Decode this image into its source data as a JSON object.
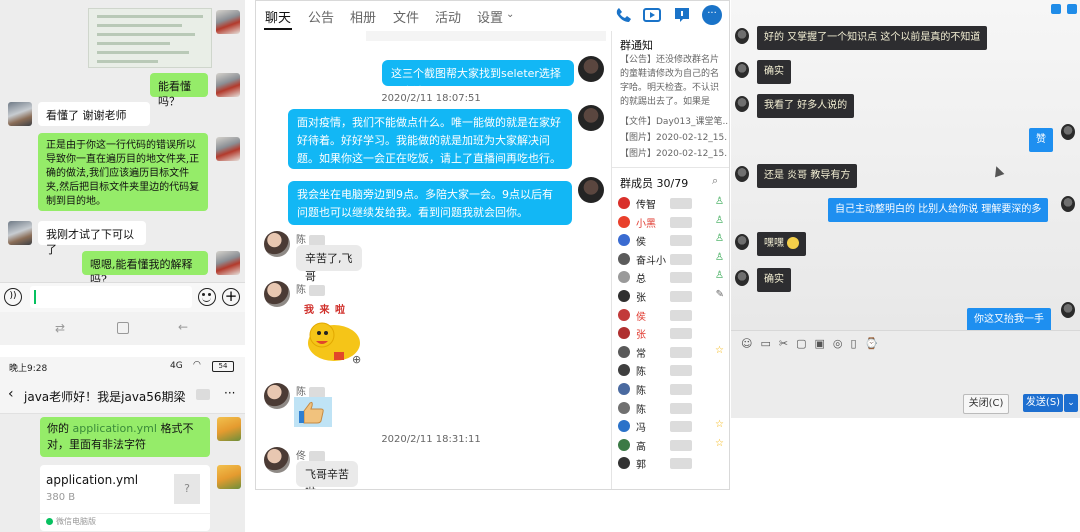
{
  "panel_a": {
    "messages": [
      {
        "side": "right",
        "text": "能看懂吗？"
      },
      {
        "side": "left",
        "text": "看懂了 谢谢老师"
      },
      {
        "side": "right",
        "text": "正是由于你这一行代码的错误所以导致你一直在遍历目的地文件夹,正确的做法,我们应该遍历目标文件夹,然后把目标文件夹里边的代码复制到目的地。"
      },
      {
        "side": "left",
        "text": "我刚才试了下可以了"
      },
      {
        "side": "right",
        "text": "嗯嗯,能看懂我的解释吗?"
      }
    ]
  },
  "panel_b": {
    "time": "晚上9:28",
    "signal": "4G",
    "battery": "54",
    "title": "java老师好！我是java56期梁",
    "more": "···",
    "message": {
      "prefix": "你的 ",
      "highlight": "application.yml",
      "suffix": " 格式不对，里面有非法字符"
    },
    "file": {
      "name": "application.yml",
      "size": "380 B",
      "source": "微信电脑版",
      "icon_text": "?"
    }
  },
  "panel_c": {
    "tabs": [
      "聊天",
      "公告",
      "相册",
      "文件",
      "活动",
      "设置"
    ],
    "messages": [
      {
        "side": "right",
        "text": "这三个截图帮大家找到seleter选择器方法"
      },
      {
        "time": "2020/2/11 18:07:51"
      },
      {
        "side": "right",
        "text": "面对疫情，我们不能做点什么。唯一能做的就是在家好好待着。好好学习。我能做的就是加班为大家解决问题。如果你这一会正在吃饭，请上了直播间再吃也行。"
      },
      {
        "side": "right",
        "text": "我会坐在电脑旁边到9点。多陪大家一会。9点以后有问题也可以继续发给我。看到问题我就会回你。"
      },
      {
        "side": "left",
        "name": "陈",
        "text": "辛苦了,飞哥"
      },
      {
        "side": "left",
        "name": "陈",
        "sticker": "我 来 啦"
      },
      {
        "side": "left",
        "name": "陈",
        "sticker": "thumbs-up"
      },
      {
        "time": "2020/2/11 18:31:11"
      },
      {
        "side": "left",
        "name": "佟",
        "text": "飞哥辛苦啦"
      }
    ],
    "notice": {
      "title": "群通知",
      "text": "【公告】还没修改群名片的童鞋请修改为自己的名字哈。明天检查。不认识的就踢出去了。如果是本...",
      "items": [
        "【文件】Day013_课堂笔...",
        "【图片】2020-02-12_15...",
        "【图片】2020-02-12_15..."
      ]
    },
    "members_title": "群成员 30/79",
    "members": [
      {
        "name": "传智",
        "color": "#d9302b",
        "badge": "admin"
      },
      {
        "name": "小黑",
        "color": "#e9402c",
        "badge": "admin",
        "red": true
      },
      {
        "name": "侯",
        "color": "#3a6bd1",
        "badge": "admin"
      },
      {
        "name": "奋斗小",
        "color": "#5b5b5b",
        "badge": "admin"
      },
      {
        "name": "总",
        "color": "#9a9a9a",
        "badge": "admin"
      },
      {
        "name": "张",
        "color": "#2f2f2f",
        "badge": "edit"
      },
      {
        "name": "侯",
        "color": "#c23a3a",
        "badge": "",
        "red": true
      },
      {
        "name": "张",
        "color": "#b03030",
        "badge": "",
        "red": true
      },
      {
        "name": "常",
        "color": "#5a5a5a",
        "badge": "star"
      },
      {
        "name": "陈",
        "color": "#3f3f3f",
        "badge": ""
      },
      {
        "name": "陈",
        "color": "#4a6aa0",
        "badge": ""
      },
      {
        "name": "陈",
        "color": "#707070",
        "badge": ""
      },
      {
        "name": "冯",
        "color": "#2b72c9",
        "badge": "star"
      },
      {
        "name": "高",
        "color": "#3b7a45",
        "badge": "star"
      },
      {
        "name": "郭",
        "color": "#333333",
        "badge": ""
      }
    ]
  },
  "panel_d": {
    "messages": [
      {
        "side": "left",
        "text": "好的 又掌握了一个知识点 这个以前是真的不知道"
      },
      {
        "side": "left",
        "text": "确实"
      },
      {
        "side": "left",
        "text": "我看了 好多人说的"
      },
      {
        "side": "right",
        "text": "赞"
      },
      {
        "side": "left",
        "text": "还是 炎哥 教导有方"
      },
      {
        "side": "right",
        "text": "自己主动整明白的 比别人给你说 理解要深的多"
      },
      {
        "side": "left",
        "text": "嘿嘿"
      },
      {
        "side": "left",
        "text": "确实"
      },
      {
        "side": "right",
        "text": "你这又抬我一手"
      }
    ],
    "close_label": "关闭(C)",
    "send_label": "发送(S)"
  },
  "colors": {
    "wechat_green": "#95ec69",
    "wechat_link": "#3a8a3a",
    "qq_blue": "#12b7f5",
    "qq_tab_active": "#111111",
    "photo_dark_bubble": "#2d2d30",
    "photo_blue_bubble": "#1e8ff0"
  },
  "icons": [
    "voice-icon",
    "emoji-icon",
    "plus-icon",
    "back-icon",
    "phone-icon",
    "video-icon",
    "screen-share-icon",
    "more-icon",
    "search-icon",
    "star-icon",
    "edit-icon",
    "zoom-icon"
  ]
}
